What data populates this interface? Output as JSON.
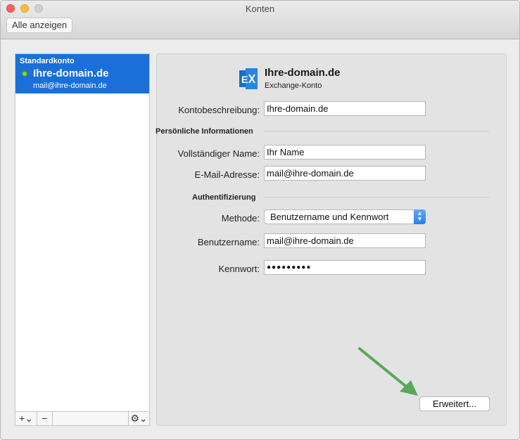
{
  "window": {
    "title": "Konten",
    "show_all_label": "Alle anzeigen"
  },
  "sidebar": {
    "account": {
      "header": "Standardkonto",
      "name": "Ihre-domain.de",
      "email": "mail@ihre-domain.de",
      "status_color": "#7fd33f"
    },
    "footer": {
      "add_label": "+⌄",
      "remove_label": "−",
      "gear_label": "⚙⌄"
    }
  },
  "panel": {
    "account_title": "Ihre-domain.de",
    "account_type": "Exchange-Konto",
    "icon": "exchange-icon",
    "fields": {
      "description": {
        "label": "Kontobeschreibung:",
        "value": "Ihre-domain.de"
      },
      "full_name": {
        "label": "Vollständiger Name:",
        "value": "Ihr Name"
      },
      "email": {
        "label": "E-Mail-Adresse:",
        "value": "mail@ihre-domain.de"
      },
      "method": {
        "label": "Methode:",
        "value": "Benutzername und Kennwort"
      },
      "username": {
        "label": "Benutzername:",
        "value": "mail@ihre-domain.de"
      },
      "password": {
        "label": "Kennwort:",
        "value": "●●●●●●●●●"
      }
    },
    "sections": {
      "personal": "Persönliche Informationen",
      "auth": "Authentifizierung"
    },
    "advanced_label": "Erweitert...",
    "accent_color": "#1a6fd9",
    "annotation_arrow_color": "#5aa85a"
  }
}
